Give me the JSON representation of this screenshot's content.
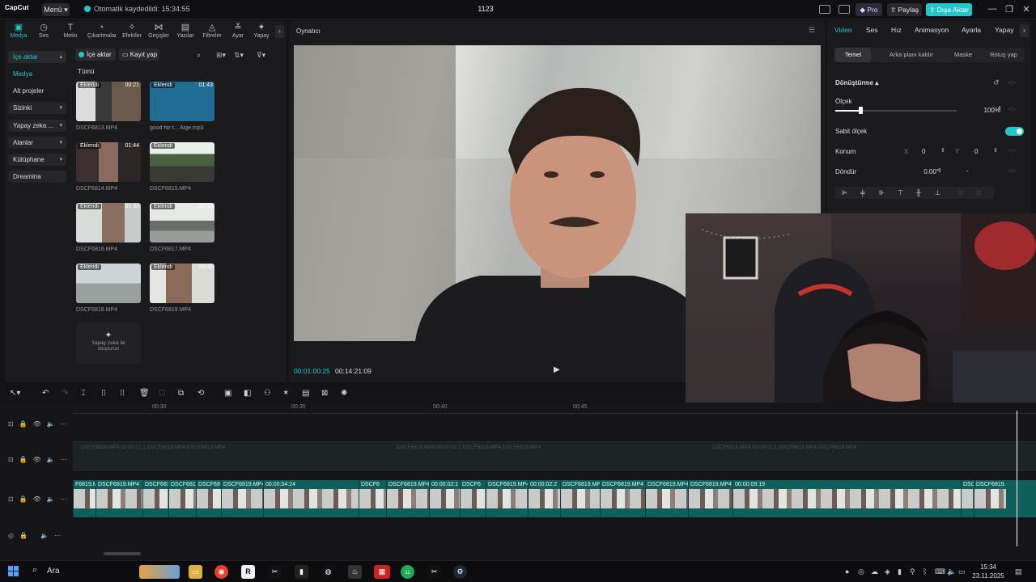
{
  "titlebar": {
    "logo": "CapCut",
    "menu": "Menü",
    "autosave": "Otomatik kaydedildi: 15:34:55",
    "project": "1123",
    "pro": "Pro",
    "share": "Paylaş",
    "export": "Dışa Aktar",
    "min": "—",
    "max": "❐",
    "close": "✕"
  },
  "categories": [
    {
      "label": "Medya",
      "icon": "▣"
    },
    {
      "label": "Ses",
      "icon": "◷"
    },
    {
      "label": "Metin",
      "icon": "T"
    },
    {
      "label": "Çıkartmalar",
      "icon": "◔"
    },
    {
      "label": "Efektler",
      "icon": "✧"
    },
    {
      "label": "Geçişler",
      "icon": "⋈"
    },
    {
      "label": "Yazılar",
      "icon": "▤"
    },
    {
      "label": "Filtreler",
      "icon": "◬"
    },
    {
      "label": "Ayar",
      "icon": "≚"
    },
    {
      "label": "Yapay",
      "icon": "✦"
    }
  ],
  "sidenav": [
    "İçe aktar",
    "Medya",
    "Alt projeler",
    "Sizinki",
    "Yapay zeka ...",
    "Alanlar",
    "Kütüphane",
    "Dreamina"
  ],
  "media_toolbar": {
    "import": "İçe aktar",
    "record": "Kayıt yap"
  },
  "all_label": "Tümü",
  "media": [
    {
      "name": "DSCF6813.MP4",
      "badge": "Eklendi",
      "duration": "00:21"
    },
    {
      "name": "good for t... Alge.mp3",
      "badge": "Eklendi",
      "duration": "01:43"
    },
    {
      "name": "DSCF6814.MP4",
      "badge": "Eklendi",
      "duration": "01:44"
    },
    {
      "name": "DSCF6815.MP4",
      "badge": "Eklendi",
      "duration": ""
    },
    {
      "name": "DSCF6816.MP4",
      "badge": "Eklendi",
      "duration": "01:32"
    },
    {
      "name": "DSCF6817.MP4",
      "badge": "Eklendi",
      "duration": "00:13"
    },
    {
      "name": "DSCF6818.MP4",
      "badge": "Eklendi",
      "duration": ""
    },
    {
      "name": "DSCF6819.MP4",
      "badge": "Eklendi",
      "duration": "00:38"
    }
  ],
  "ai_create": {
    "line1": "Yapay zekâ ile",
    "line2": "oluşturun"
  },
  "player": {
    "title": "Oynatıcı",
    "time_current": "00:01:00:25",
    "time_total": "00:14:21:09"
  },
  "right": {
    "tabs": [
      "Video",
      "Ses",
      "Hız",
      "Animasyon",
      "Ayarla",
      "Yapay"
    ],
    "subtabs": [
      "Temel",
      "Arka planı kaldır",
      "Maske",
      "Rötuş yap"
    ],
    "section": "Dönüştürme",
    "scale_label": "Ölçek",
    "scale_value": "100%",
    "uniform_label": "Sabit ölçek",
    "position_label": "Konum",
    "pos_x_label": "X",
    "pos_x": "0",
    "pos_y_label": "Y",
    "pos_y": "0",
    "rotate_label": "Döndür",
    "rotate_value": "0.00°"
  },
  "ruler": [
    "00:30",
    "00:35",
    "00:40",
    "00:45"
  ],
  "clips": [
    {
      "label": "F6819.MI",
      "w": 28
    },
    {
      "label": "DSCF6819.MP4",
      "w": 58
    },
    {
      "label": "DSCF681",
      "w": 32
    },
    {
      "label": "DSCF6819.",
      "w": 34
    },
    {
      "label": "DSCF68",
      "w": 31
    },
    {
      "label": "DSCF6819.MP4",
      "w": 52
    },
    {
      "label": "00:00:04:24",
      "w": 118
    },
    {
      "label": "DSCF6",
      "w": 34
    },
    {
      "label": "DSCF6819.MP4",
      "w": 53
    },
    {
      "label": "00:00:02:1",
      "w": 38
    },
    {
      "label": "DSCF6",
      "w": 32
    },
    {
      "label": "DSCF6819.MP4",
      "w": 52
    },
    {
      "label": "00:00:02:2",
      "w": 40
    },
    {
      "label": "DSCF6819.MP4",
      "w": 49
    },
    {
      "label": "DSCF6819.MP4",
      "w": 56
    },
    {
      "label": "DSCF6819.MP4",
      "w": 53
    },
    {
      "label": "DSCF6819.MP4",
      "w": 55
    },
    {
      "label": "00:00:09:19",
      "w": 282
    },
    {
      "label": "DSCI",
      "w": 16
    },
    {
      "label": "DSCF6819.M",
      "w": 40
    }
  ],
  "ghost_track_text": "DSCF6819.MP4  00:00:02:1  DSCF6819.MP4  DSCF6819.MP4",
  "taskbar": {
    "search": "Ara",
    "time": "15:34",
    "date": "23.11.2025",
    "whatsapp_badge": "11"
  }
}
